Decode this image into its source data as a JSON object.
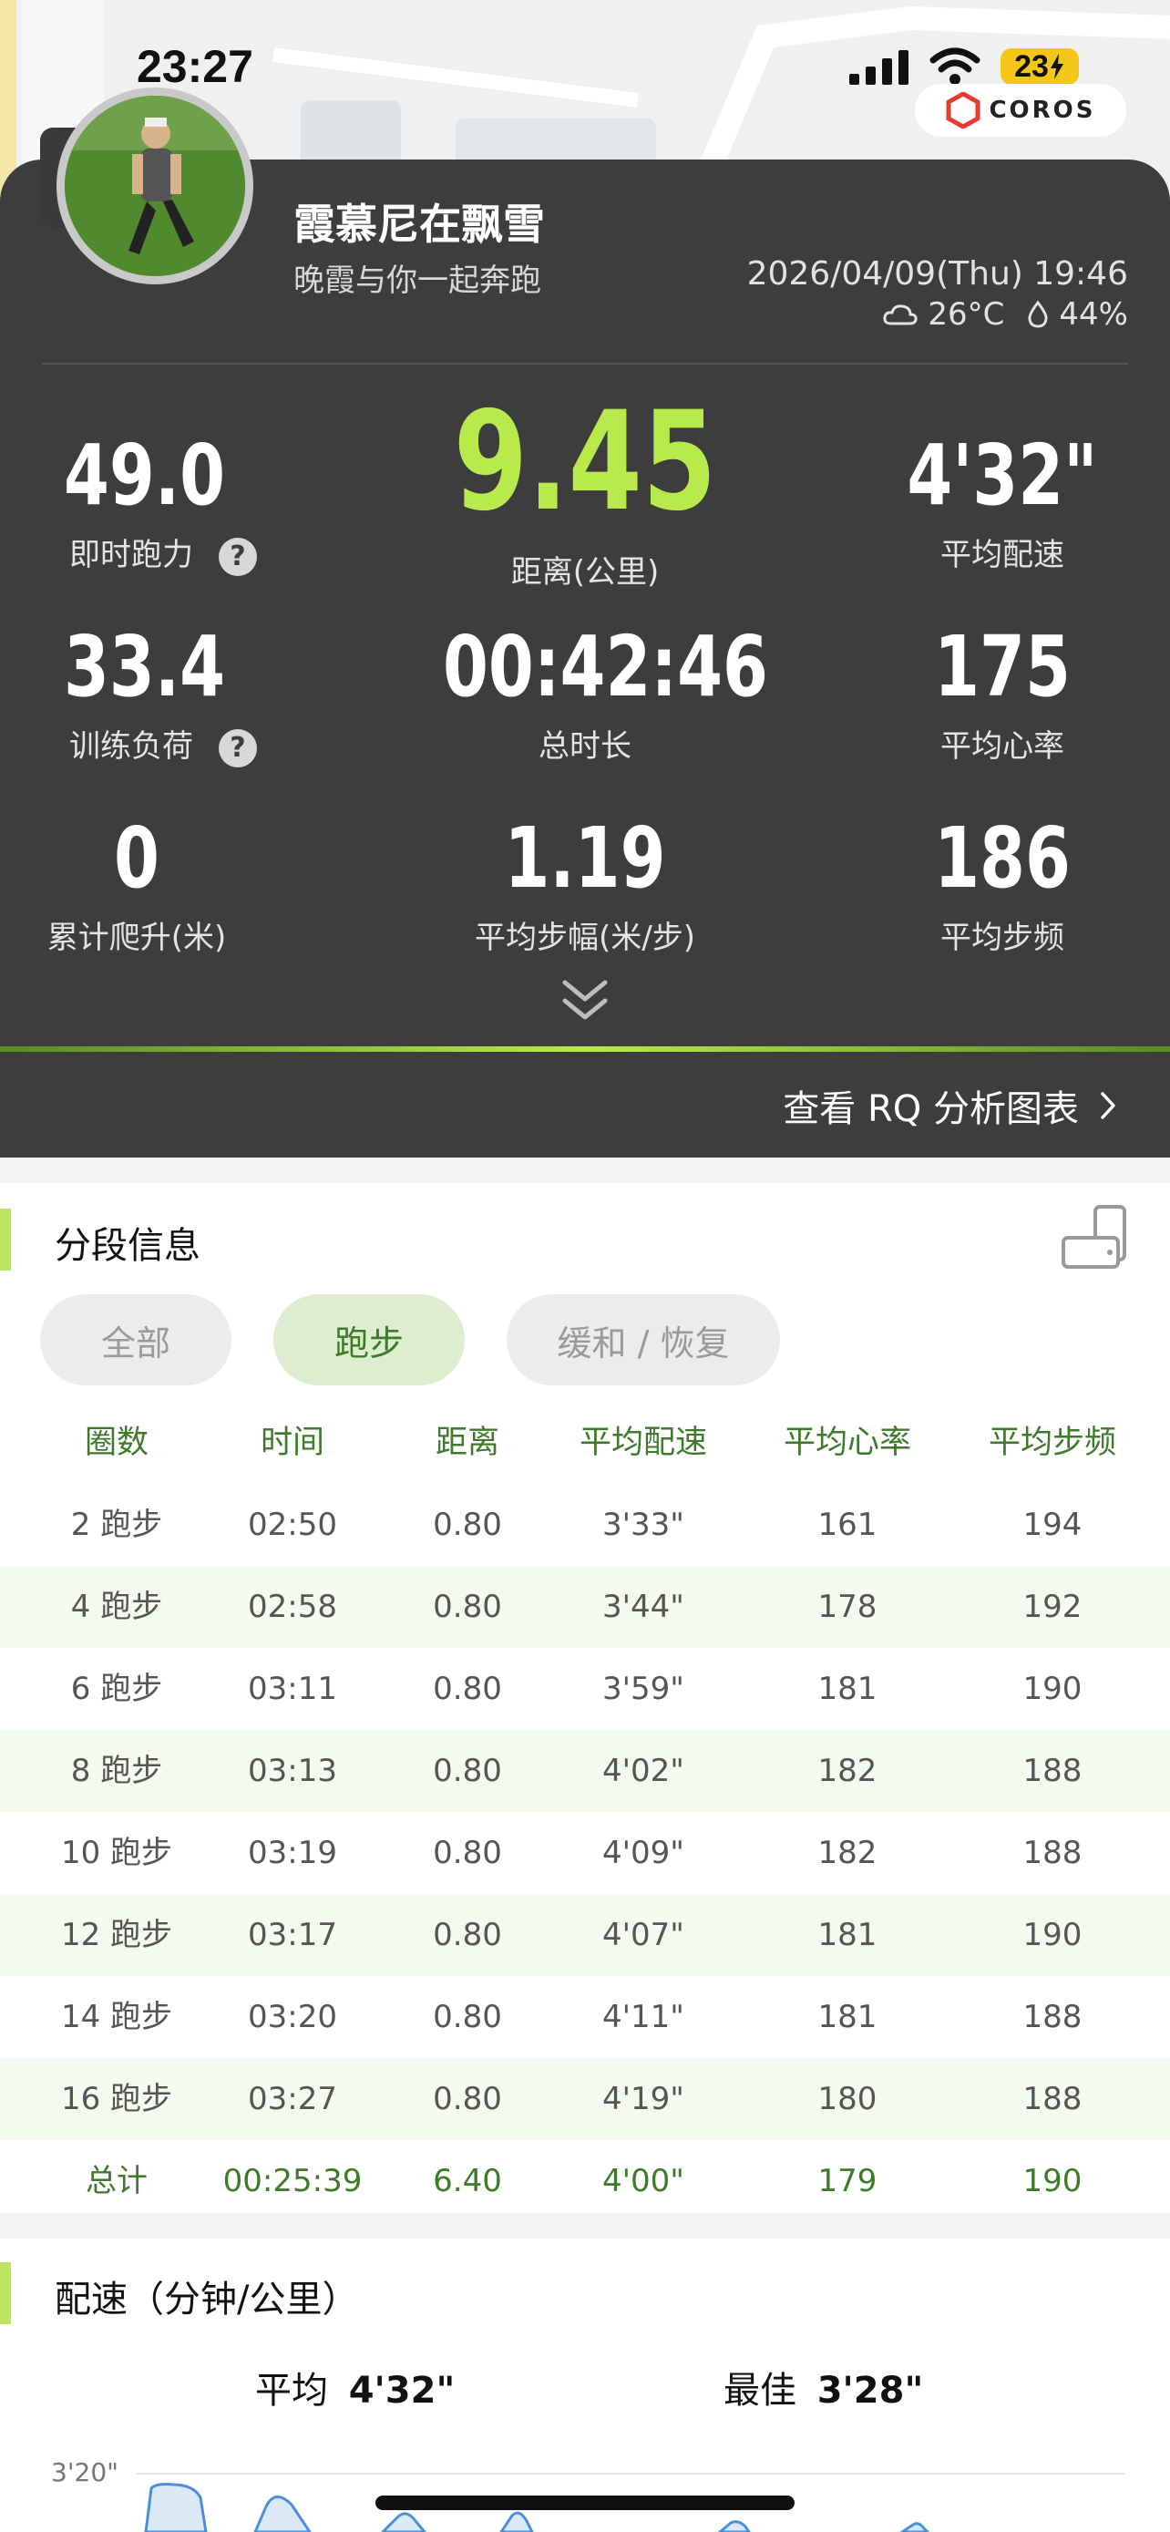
{
  "status_bar": {
    "time": "23:27",
    "battery": "23"
  },
  "brand": {
    "logo_text": "COROS"
  },
  "user": {
    "name": "霞慕尼在飘雪",
    "subtitle": "晚霞与你一起奔跑"
  },
  "activity": {
    "datetime": "2026/04/09(Thu) 19:46",
    "temperature": "26°C",
    "humidity": "44%"
  },
  "stats": [
    {
      "value": "49.0",
      "label": "即时跑力",
      "help": "?"
    },
    {
      "value": "9.45",
      "label": "距离(公里)"
    },
    {
      "value": "4'32\"",
      "label": "平均配速"
    },
    {
      "value": "33.4",
      "label": "训练负荷",
      "help": "?"
    },
    {
      "value": "00:42:46",
      "label": "总时长"
    },
    {
      "value": "175",
      "label": "平均心率"
    },
    {
      "value": "0",
      "label": "累计爬升(米)"
    },
    {
      "value": "1.19",
      "label": "平均步幅(米/步)"
    },
    {
      "value": "186",
      "label": "平均步频"
    }
  ],
  "rq_link": "查看 RQ 分析图表",
  "segments": {
    "title": "分段信息",
    "filters": [
      "全部",
      "跑步",
      "缓和 / 恢复"
    ],
    "headers": [
      "圈数",
      "时间",
      "距离",
      "平均配速",
      "平均心率",
      "平均步频"
    ],
    "rows": [
      [
        "2 跑步",
        "02:50",
        "0.80",
        "3'33\"",
        "161",
        "194"
      ],
      [
        "4 跑步",
        "02:58",
        "0.80",
        "3'44\"",
        "178",
        "192"
      ],
      [
        "6 跑步",
        "03:11",
        "0.80",
        "3'59\"",
        "181",
        "190"
      ],
      [
        "8 跑步",
        "03:13",
        "0.80",
        "4'02\"",
        "182",
        "188"
      ],
      [
        "10 跑步",
        "03:19",
        "0.80",
        "4'09\"",
        "182",
        "188"
      ],
      [
        "12 跑步",
        "03:17",
        "0.80",
        "4'07\"",
        "181",
        "190"
      ],
      [
        "14 跑步",
        "03:20",
        "0.80",
        "4'11\"",
        "181",
        "188"
      ],
      [
        "16 跑步",
        "03:27",
        "0.80",
        "4'19\"",
        "180",
        "188"
      ]
    ],
    "total": [
      "总计",
      "00:25:39",
      "6.40",
      "4'00\"",
      "179",
      "190"
    ]
  },
  "pace": {
    "title": "配速（分钟/公里）",
    "avg_label": "平均",
    "avg_value": "4'32\"",
    "best_label": "最佳",
    "best_value": "3'28\"",
    "axis_top": "3'20\""
  },
  "colors": {
    "accent_green": "#b8ea4c",
    "table_green": "#3d7a2a",
    "card_dark": "#3d3d3d"
  }
}
